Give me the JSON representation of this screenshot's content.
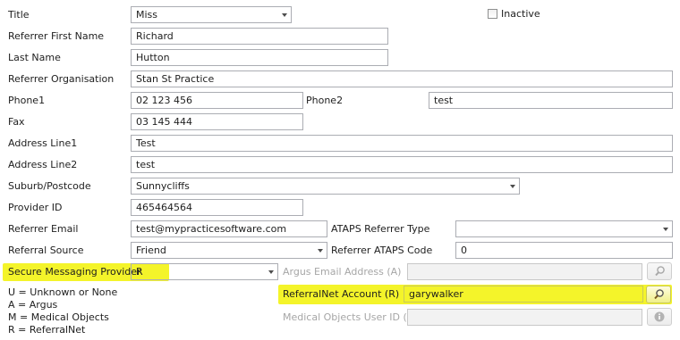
{
  "form": {
    "title": {
      "label": "Title",
      "value": "Miss"
    },
    "inactive": {
      "label": "Inactive",
      "checked": false
    },
    "referrer_first_name": {
      "label": "Referrer First Name",
      "value": "Richard"
    },
    "last_name": {
      "label": "Last Name",
      "value": "Hutton"
    },
    "referrer_organisation": {
      "label": "Referrer Organisation",
      "value": "Stan St Practice"
    },
    "phone1": {
      "label": "Phone1",
      "value": "02 123 456"
    },
    "phone2": {
      "label": "Phone2",
      "value": "test"
    },
    "fax": {
      "label": "Fax",
      "value": "03 145 444"
    },
    "address_line1": {
      "label": "Address Line1",
      "value": "Test"
    },
    "address_line2": {
      "label": "Address Line2",
      "value": "test"
    },
    "suburb_postcode": {
      "label": "Suburb/Postcode",
      "value": "Sunnycliffs"
    },
    "provider_id": {
      "label": "Provider ID",
      "value": "465464564"
    },
    "referrer_email": {
      "label": "Referrer Email",
      "value": "test@mypracticesoftware.com"
    },
    "ataps_referrer_type": {
      "label": "ATAPS Referrer Type",
      "value": ""
    },
    "referral_source": {
      "label": "Referral Source",
      "value": "Friend"
    },
    "referrer_ataps_code": {
      "label": "Referrer ATAPS Code",
      "value": "0"
    },
    "secure_messaging_provider": {
      "label": "Secure Messaging Provider",
      "value": "R"
    },
    "argus_email_address": {
      "label": "Argus Email Address (A)",
      "value": ""
    },
    "referralnet_account": {
      "label": "ReferralNet Account (R)",
      "value": "garywalker"
    },
    "medical_objects_user_id": {
      "label": "Medical Objects User ID (M)",
      "value": ""
    }
  },
  "provider_legend": [
    "U = Unknown or None",
    "A = Argus",
    "M = Medical Objects",
    "R = ReferralNet"
  ],
  "icons": {
    "search": "magnifier-icon",
    "info": "info-icon"
  },
  "colors": {
    "highlight": "#f4f42a",
    "field_border": "#abadb3",
    "disabled_text": "#a6a6a6"
  }
}
